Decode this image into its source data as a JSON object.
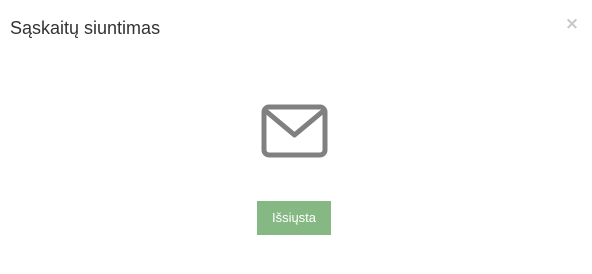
{
  "dialog": {
    "title": "Sąskaitų siuntimas",
    "close_label": "×",
    "icon": "envelope-icon",
    "status_button_label": "Išsiųsta"
  },
  "colors": {
    "title_text": "#333333",
    "close": "#c7c7c7",
    "icon_stroke": "#808080",
    "button_bg": "#86b884",
    "button_text": "#ffffff"
  }
}
